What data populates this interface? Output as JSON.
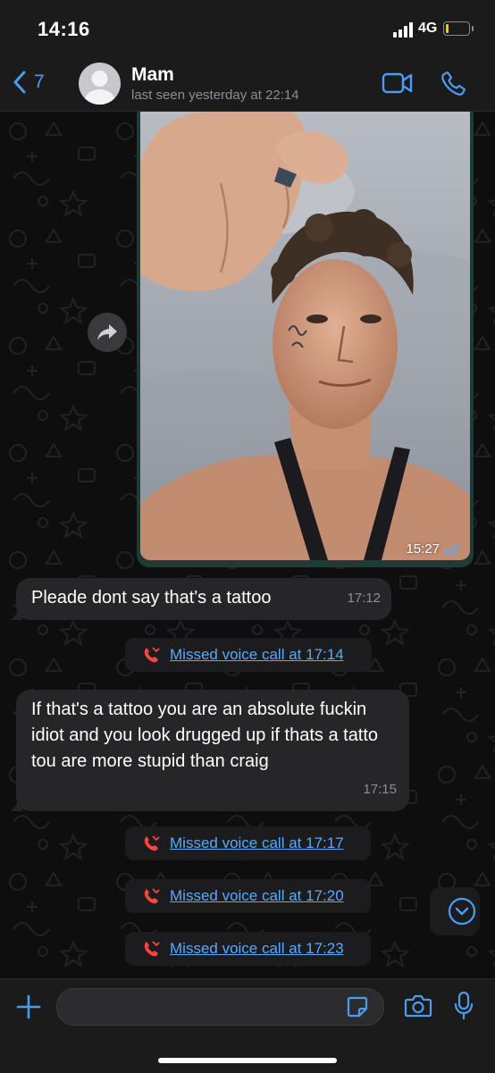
{
  "status_bar": {
    "time": "14:16",
    "network": "4G",
    "battery_level": 0.1
  },
  "header": {
    "back_count": "7",
    "contact_name": "Mam",
    "last_seen": "last seen yesterday at 22:14"
  },
  "photo_message": {
    "time": "15:27",
    "status": "read"
  },
  "messages": [
    {
      "text": "Pleade dont say that's a tattoo",
      "time": "17:12"
    },
    {
      "text": "If that's  a tattoo you are an absolute fuckin idiot and you look drugged up  if thats a tatto tou are more stupid than craig",
      "time": "17:15"
    }
  ],
  "missed_calls": [
    {
      "label": "Missed voice call at 17:14"
    },
    {
      "label": "Missed voice call at 17:17"
    },
    {
      "label": "Missed voice call at 17:20"
    },
    {
      "label": "Missed voice call at 17:23"
    }
  ],
  "colors": {
    "accent": "#4a9cf0",
    "bubble_incoming": "#262628",
    "missed_call": "#ff453a",
    "link": "#5aa9ff"
  }
}
